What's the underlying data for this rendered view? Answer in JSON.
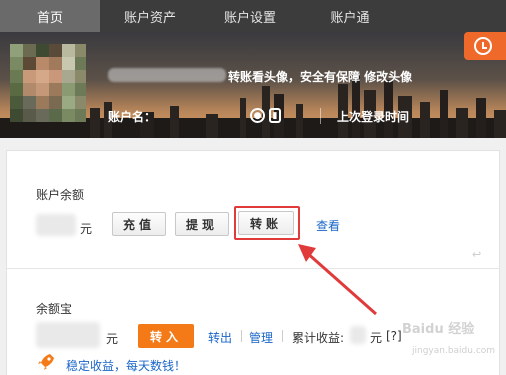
{
  "nav": {
    "tabs": [
      {
        "label": "首页",
        "active": true
      },
      {
        "label": "账户资产"
      },
      {
        "label": "账户设置"
      },
      {
        "label": "账户通"
      }
    ]
  },
  "banner": {
    "avatar_tip": "转账看头像，安全有保障 修改头像",
    "account_label": "账户名：",
    "last_login_label": "上次登录时间"
  },
  "balance": {
    "title": "账户余额",
    "unit": "元",
    "recharge_label": "充值",
    "withdraw_label": "提现",
    "transfer_label": "转账",
    "view_label": "查看"
  },
  "yuebao": {
    "title": "余额宝",
    "unit": "元",
    "transfer_in_label": "转入",
    "transfer_out_label": "转出",
    "manage_label": "管理",
    "cumulative_label": "累计收益:",
    "cumulative_unit": "元",
    "badge": "[?]",
    "slogan": "稳定收益，每天数钱！"
  },
  "watermark": {
    "text": "Baidu 经验",
    "url": "jingyan.baidu.com"
  },
  "colors": {
    "accent_orange": "#f47a18",
    "link_blue": "#1a66c8",
    "annotation_red": "#e03a3a"
  }
}
